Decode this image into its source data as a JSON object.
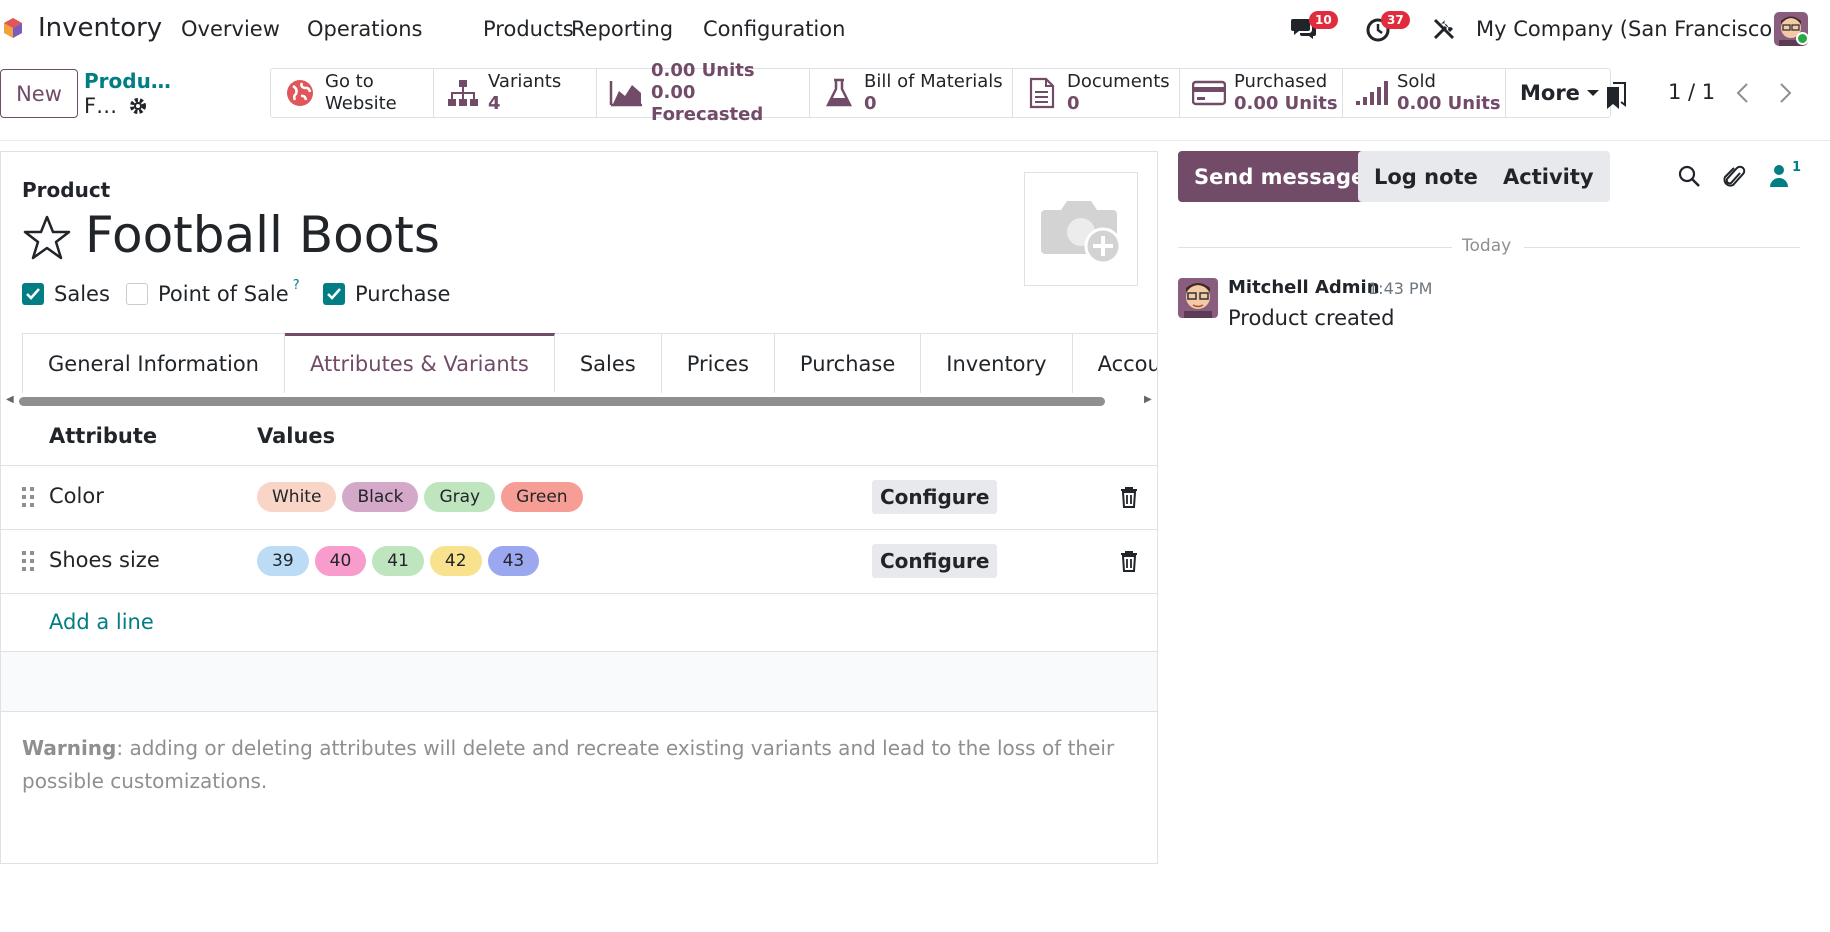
{
  "navbar": {
    "app_name": "Inventory",
    "menu": [
      "Overview",
      "Operations",
      "Products",
      "Reporting",
      "Configuration"
    ],
    "messages_count": "10",
    "activities_count": "37",
    "company": "My Company (San Francisco)"
  },
  "control_panel": {
    "new_label": "New",
    "breadcrumb_parent": "Produ…",
    "breadcrumb_current": "F…",
    "smart_buttons": {
      "website": {
        "line1": "Go to",
        "line2": "Website"
      },
      "variants": {
        "line1": "Variants",
        "line2": "4"
      },
      "forecast": {
        "line1": "0.00 Units",
        "line2": "0.00 Forecasted"
      },
      "bom": {
        "line1": "Bill of Materials",
        "line2": "0"
      },
      "documents": {
        "line1": "Documents",
        "line2": "0"
      },
      "purchased": {
        "line1": "Purchased",
        "line2": "0.00 Units"
      },
      "sold": {
        "line1": "Sold",
        "line2": "0.00 Units"
      },
      "more": "More"
    },
    "pager": "1 / 1"
  },
  "form": {
    "label": "Product",
    "product_name": "Football Boots",
    "checkboxes": {
      "sales": {
        "label": "Sales",
        "checked": true
      },
      "pos": {
        "label": "Point of Sale",
        "help": "?",
        "checked": false
      },
      "purchase": {
        "label": "Purchase",
        "checked": true
      }
    },
    "tabs": [
      "General Information",
      "Attributes & Variants",
      "Sales",
      "Prices",
      "Purchase",
      "Inventory",
      "Accounting"
    ],
    "active_tab": "Attributes & Variants",
    "table": {
      "headers": [
        "Attribute",
        "Values"
      ],
      "rows": [
        {
          "attribute": "Color",
          "values": [
            {
              "label": "White",
              "color": "#f8d5c6"
            },
            {
              "label": "Black",
              "color": "#d4a8c9"
            },
            {
              "label": "Gray",
              "color": "#bfe5bf"
            },
            {
              "label": "Green",
              "color": "#f69d95"
            }
          ],
          "configure": "Configure"
        },
        {
          "attribute": "Shoes size",
          "values": [
            {
              "label": "39",
              "color": "#bcdcf6"
            },
            {
              "label": "40",
              "color": "#f79ccc"
            },
            {
              "label": "41",
              "color": "#bfe5bf"
            },
            {
              "label": "42",
              "color": "#f9e28e"
            },
            {
              "label": "43",
              "color": "#9ba7ef"
            }
          ],
          "configure": "Configure"
        }
      ],
      "add_line": "Add a line"
    },
    "warning_title": "Warning",
    "warning_text": ": adding or deleting attributes will delete and recreate existing variants and lead to the loss of their possible customizations."
  },
  "chatter": {
    "send_message": "Send message",
    "log_note": "Log note",
    "activity": "Activity",
    "followers_count": "1",
    "date_separator": "Today",
    "message": {
      "author": "Mitchell Admin",
      "time": "1:43 PM",
      "body": "Product created"
    }
  },
  "colors": {
    "primary": "#714b67",
    "accent": "#017e84",
    "badge": "#e02c3c"
  }
}
